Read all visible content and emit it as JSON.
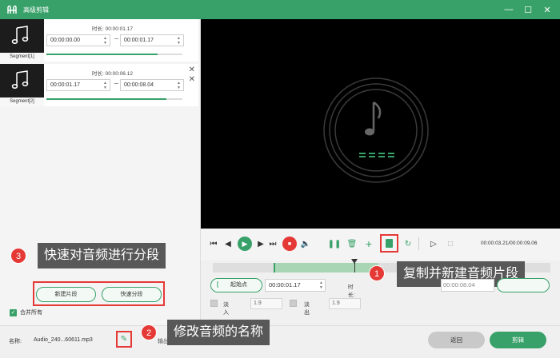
{
  "window": {
    "title": "高级剪辑",
    "logo_icon": "app-logo-icon",
    "accent": "#38a169"
  },
  "segments": [
    {
      "label": "Segment[1]",
      "duration": "时长: 00:00:01.17",
      "start": "00:00:00.00",
      "end": "00:00:01.17",
      "progress": 0.82
    },
    {
      "label": "Segment[2]",
      "duration": "时长: 00:00:06.12",
      "start": "00:00:01.17",
      "end": "00:00:08.04",
      "progress": 0.88
    }
  ],
  "left_actions": {
    "new_segment": "新建片段",
    "quick_split": "快速分段",
    "merge_all": "合并所有"
  },
  "transport": {
    "time_readout": "00:00:03.21/00:00:09.06"
  },
  "timeline": {
    "selected_start": 0.18,
    "selected_end": 0.49,
    "playhead": 0.42
  },
  "trim": {
    "start_label": "起始点",
    "start_time": "00:00:01.17",
    "duration_label": "时长:",
    "duration_value": "00:00:06.12",
    "end_time": "00:00:08.04"
  },
  "fade": {
    "fade_in_label": "淡入",
    "fade_in_value": "1.9",
    "fade_out_label": "淡出",
    "fade_out_value": "1.9"
  },
  "bottom": {
    "name_label": "名称:",
    "file_name": "Audio_240...60611.mp3",
    "output_label": "输出",
    "back_label": "返回",
    "cut_label": "剪辑"
  },
  "callouts": [
    {
      "number": "1",
      "text": "复制并新建音频片段"
    },
    {
      "number": "2",
      "text": "修改音频的名称"
    },
    {
      "number": "3",
      "text": "快速对音频进行分段"
    }
  ]
}
